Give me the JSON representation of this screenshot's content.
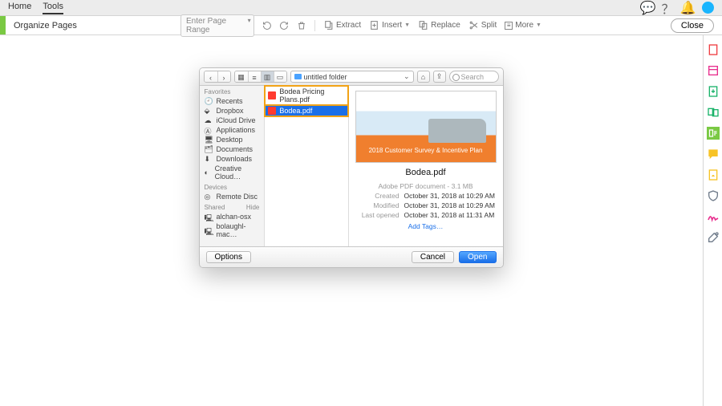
{
  "topbar": {
    "tabs": {
      "home": "Home",
      "tools": "Tools"
    }
  },
  "toolrow": {
    "title": "Organize Pages",
    "page_range_placeholder": "Enter Page Range",
    "extract": "Extract",
    "insert": "Insert",
    "replace": "Replace",
    "split": "Split",
    "more": "More",
    "close": "Close"
  },
  "finder": {
    "location": "untitled folder",
    "search_placeholder": "Search",
    "sidebar": {
      "favorites_label": "Favorites",
      "devices_label": "Devices",
      "shared_label": "Shared",
      "hide_label": "Hide",
      "favorites": [
        "Recents",
        "Dropbox",
        "iCloud Drive",
        "Applications",
        "Desktop",
        "Documents",
        "Downloads",
        "Creative Cloud…"
      ],
      "devices": [
        "Remote Disc"
      ],
      "shared": [
        "alchan-osx",
        "bolaughl-mac…"
      ]
    },
    "files": [
      {
        "name": "Bodea Pricing Plans.pdf"
      },
      {
        "name": "Bodea.pdf"
      }
    ],
    "preview": {
      "thumb_line": "2018 Customer Survey & Incentive Plan",
      "name": "Bodea.pdf",
      "kind": "Adobe PDF document - 3.1 MB",
      "labels": {
        "created": "Created",
        "modified": "Modified",
        "lastopened": "Last opened"
      },
      "created": "October 31, 2018 at 10:29 AM",
      "modified": "October 31, 2018 at 10:29 AM",
      "lastopened": "October 31, 2018 at 11:31 AM",
      "addtags": "Add Tags…"
    },
    "footer": {
      "options": "Options",
      "cancel": "Cancel",
      "open": "Open"
    }
  }
}
